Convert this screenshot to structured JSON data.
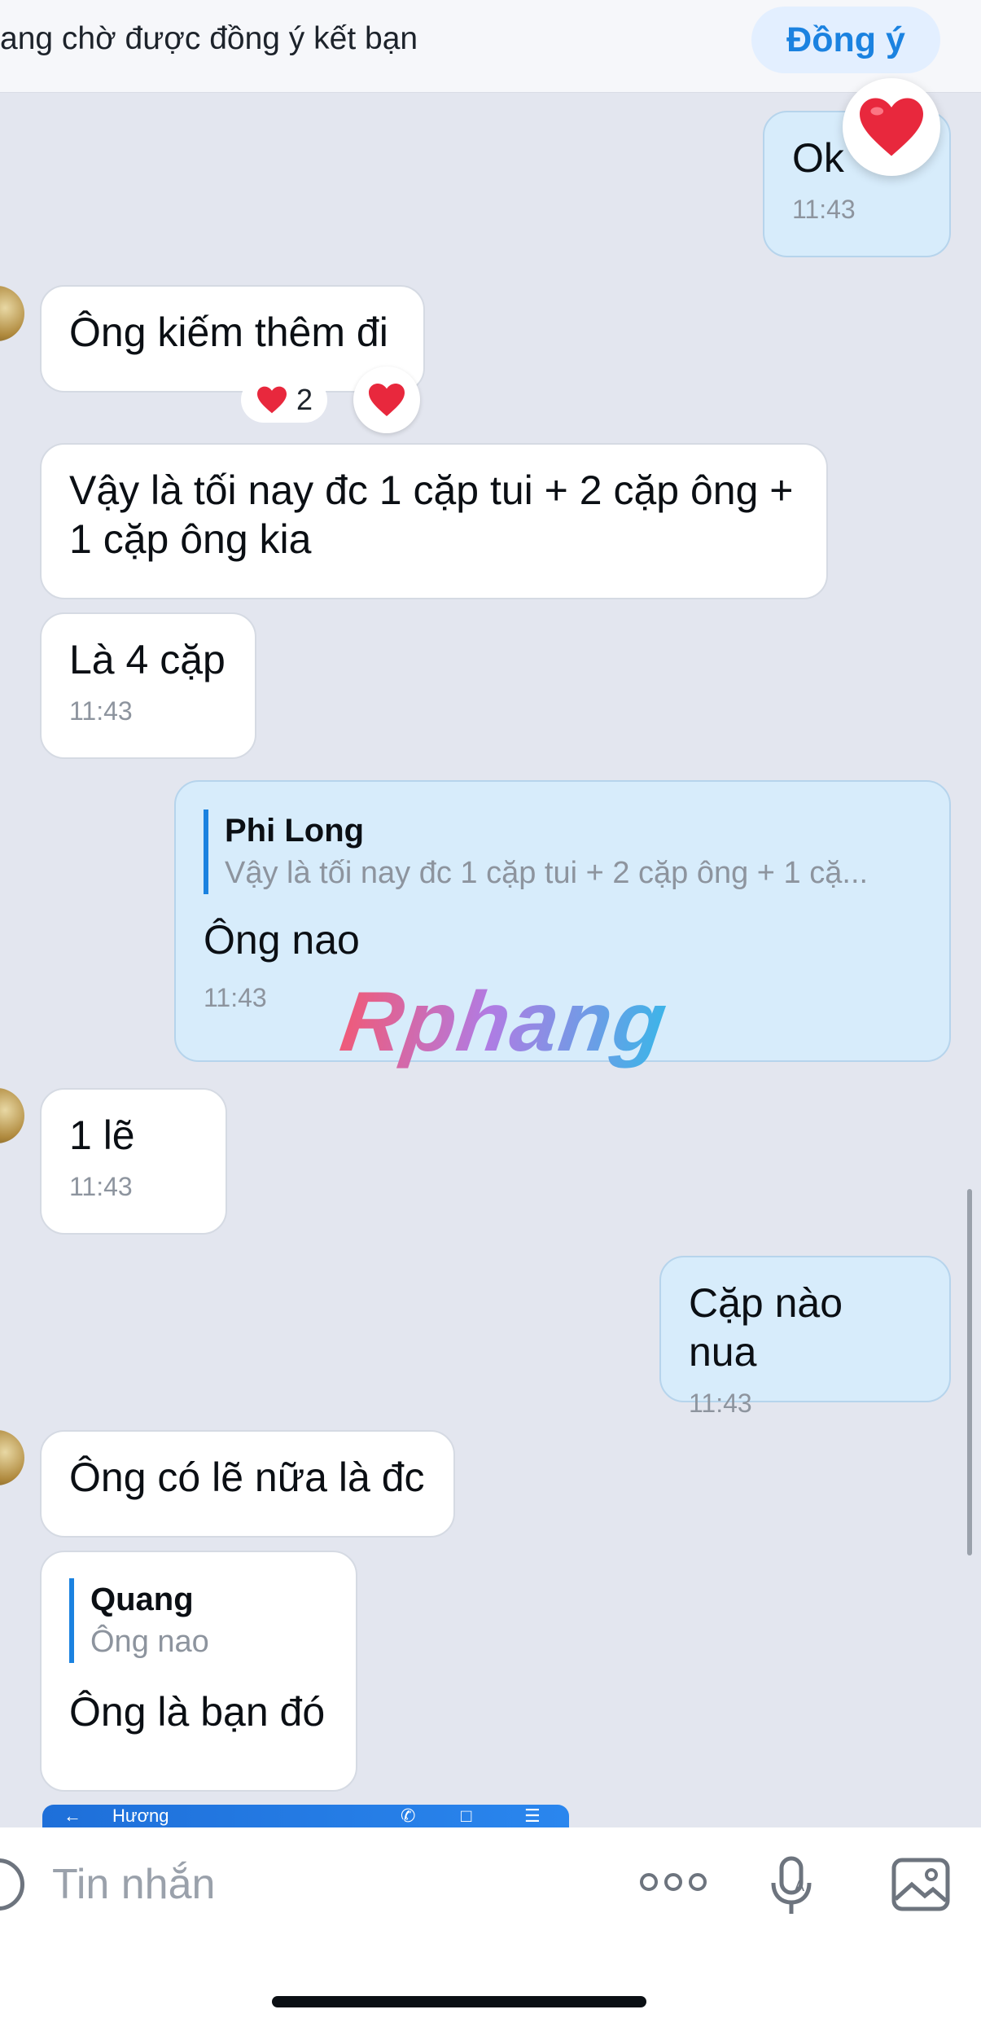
{
  "header": {
    "pending_text": "ang chờ được đồng ý kết bạn",
    "agree_button": "Đồng ý"
  },
  "messages": [
    {
      "id": "m1",
      "side": "out",
      "text": "Ok",
      "time": "11:43",
      "reaction": "heart"
    },
    {
      "id": "m2",
      "side": "in",
      "text": "Ông kiếm thêm đi",
      "reactions": {
        "count": "2"
      }
    },
    {
      "id": "m3",
      "side": "in",
      "text": "Vậy là tối nay đc 1 cặp tui + 2 cặp ông + 1 cặp ông kia"
    },
    {
      "id": "m4",
      "side": "in",
      "text": "Là 4 cặp",
      "time": "11:43"
    },
    {
      "id": "m5",
      "side": "out",
      "reply_to": {
        "name": "Phi Long",
        "text": "Vậy là tối nay đc 1 cặp tui + 2 cặp ông + 1 cặ..."
      },
      "text": "Ông nao",
      "time": "11:43"
    },
    {
      "id": "m6",
      "side": "in",
      "text": "1 lẽ",
      "time": "11:43"
    },
    {
      "id": "m7",
      "side": "out",
      "text": "Cặp nào nua",
      "time": "11:43"
    },
    {
      "id": "m8",
      "side": "in",
      "text": "Ông có lẽ nữa là đc"
    },
    {
      "id": "m9",
      "side": "in",
      "reply_to": {
        "name": "Quang",
        "text": "Ông nao"
      },
      "text": "Ông là bạn đó"
    }
  ],
  "watermark": "Rphang",
  "preview": {
    "contact": "Hương"
  },
  "composer": {
    "placeholder": "Tin nhắn",
    "icons": [
      "sticker-icon",
      "more-icon",
      "voice-icon",
      "image-icon"
    ]
  },
  "colors": {
    "outgoing_bubble": "#d7ecfb",
    "incoming_bubble": "#ffffff",
    "background": "#e3e6ef",
    "accent": "#1b82e0",
    "heart": "#e8283d"
  }
}
